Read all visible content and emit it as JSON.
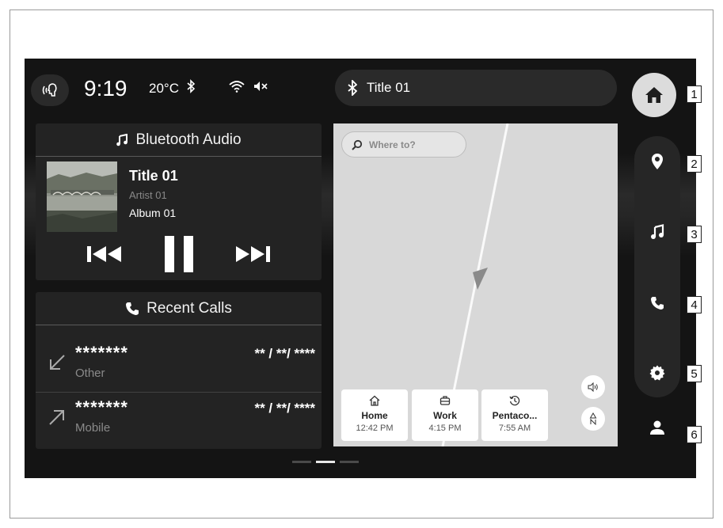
{
  "status_bar": {
    "time": "9:19",
    "temperature": "20°C",
    "now_playing_title": "Title 01"
  },
  "audio_card": {
    "header": "Bluetooth Audio",
    "track_title": "Title 01",
    "artist": "Artist 01",
    "album": "Album 01"
  },
  "calls_card": {
    "header": "Recent Calls",
    "calls": [
      {
        "name": "*******",
        "type": "Other",
        "date": "** / **/ ****",
        "direction": "incoming"
      },
      {
        "name": "*******",
        "type": "Mobile",
        "date": "** / **/ ****",
        "direction": "outgoing"
      }
    ]
  },
  "map": {
    "search_placeholder": "Where to?",
    "destinations": [
      {
        "label": "Home",
        "time": "12:42 PM",
        "icon": "home-icon"
      },
      {
        "label": "Work",
        "time": "4:15 PM",
        "icon": "briefcase-icon"
      },
      {
        "label": "Pentaco...",
        "time": "7:55 AM",
        "icon": "history-icon"
      }
    ]
  },
  "nav": {
    "items": [
      "home-icon",
      "location-pin-icon",
      "music-note-icon",
      "phone-icon",
      "gear-icon",
      "person-icon"
    ]
  },
  "callouts": [
    "1",
    "2",
    "3",
    "4",
    "5",
    "6"
  ],
  "colors": {
    "screen_bg": "#141414",
    "card_bg": "#232323",
    "map_bg": "#d8d8d8",
    "accent_white": "#ffffff"
  }
}
